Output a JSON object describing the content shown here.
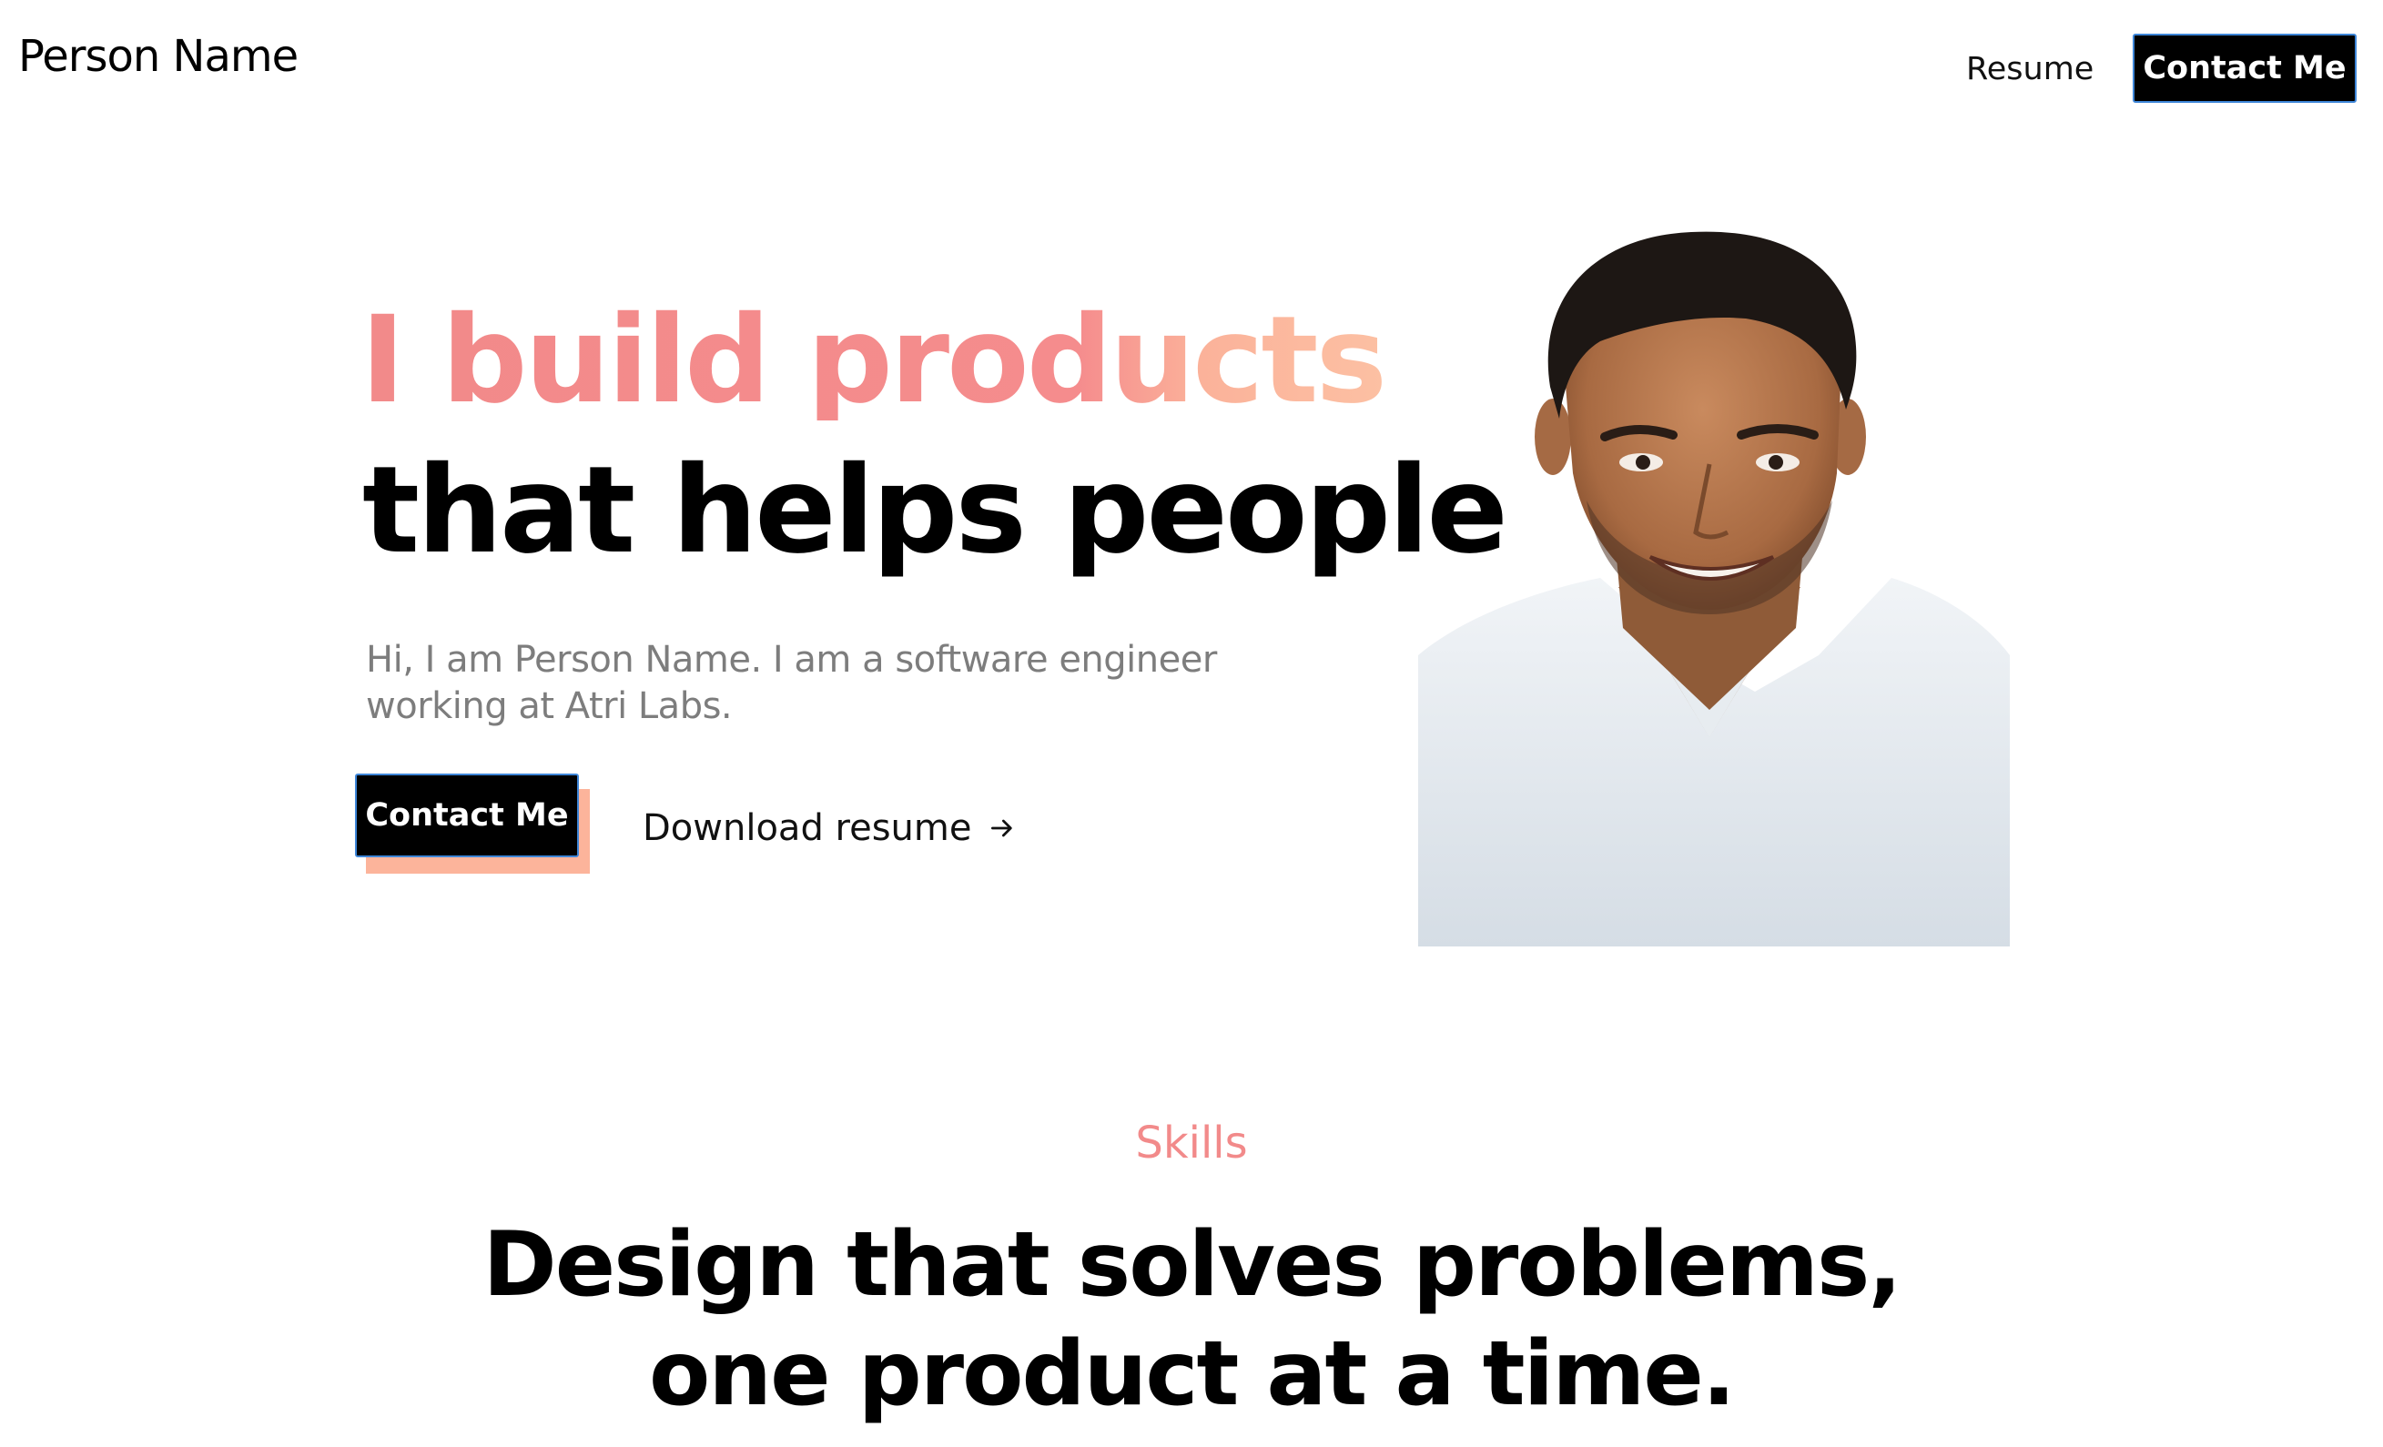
{
  "header": {
    "brand": "Person Name",
    "nav": {
      "resume": "Resume",
      "contact": "Contact Me"
    }
  },
  "hero": {
    "title_line1": "I build products",
    "title_line2": "that helps people",
    "intro": "Hi, I am Person Name. I am a software engineer working at Atri Labs.",
    "cta_label": "Contact Me",
    "download_label": "Download resume",
    "download_icon": "arrow-right-icon"
  },
  "skills": {
    "label": "Skills",
    "heading_line1": "Design that solves problems,",
    "heading_line2": "one product at a time."
  },
  "colors": {
    "accent": "#f28a8a",
    "accent_light": "#fcb49b",
    "button_bg": "#000000",
    "button_border": "#3e86d8",
    "muted_text": "#7d7d7d"
  }
}
